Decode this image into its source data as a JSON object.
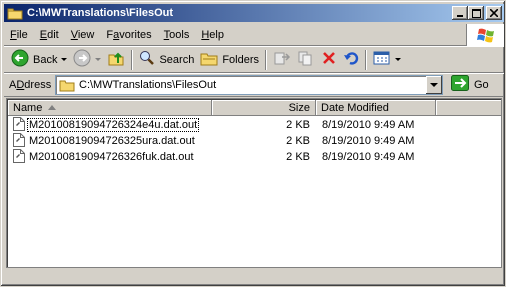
{
  "window": {
    "title": "C:\\MWTranslations\\FilesOut",
    "minimize": "_",
    "maximize": "□",
    "close": "✕"
  },
  "menu": [
    {
      "underline": "F",
      "rest": "ile"
    },
    {
      "underline": "E",
      "rest": "dit"
    },
    {
      "underline": "V",
      "rest": "iew"
    },
    {
      "prefix": "F",
      "underline": "a",
      "rest": "vorites"
    },
    {
      "underline": "T",
      "rest": "ools"
    },
    {
      "underline": "H",
      "rest": "elp"
    }
  ],
  "toolbar": {
    "back_label": "Back",
    "search_label": "Search",
    "folders_label": "Folders"
  },
  "address": {
    "label_underline": "D",
    "label_prefix": "A",
    "label_rest": "dress",
    "value": "C:\\MWTranslations\\FilesOut",
    "go_label": "Go"
  },
  "columns": {
    "name": "Name",
    "size": "Size",
    "date": "Date Modified"
  },
  "files": [
    {
      "name": "M20100819094726324e4u.dat.out",
      "size": "2 KB",
      "date": "8/19/2010 9:49 AM"
    },
    {
      "name": "M20100819094726325ura.dat.out",
      "size": "2 KB",
      "date": "8/19/2010 9:49 AM"
    },
    {
      "name": "M20100819094726326fuk.dat.out",
      "size": "2 KB",
      "date": "8/19/2010 9:49 AM"
    }
  ],
  "colors": {
    "titlebar_start": "#0a246a",
    "titlebar_end": "#a6caf0",
    "chrome": "#d4d0c8"
  },
  "icons": [
    "folder-icon",
    "back-arrow-icon",
    "forward-arrow-icon",
    "up-folder-icon",
    "search-icon",
    "folders-icon",
    "move-to-icon",
    "copy-to-icon",
    "delete-icon",
    "undo-icon",
    "views-icon",
    "go-arrow-icon",
    "file-icon"
  ]
}
